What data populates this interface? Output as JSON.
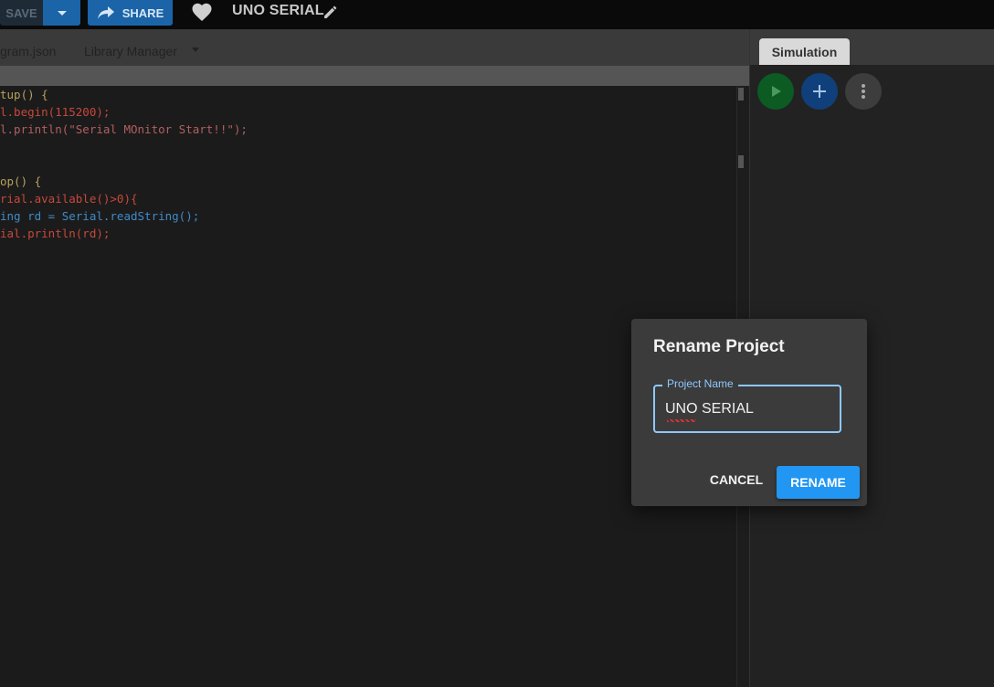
{
  "toolbar": {
    "save_label": "SAVE",
    "share_label": "SHARE",
    "project_title": "UNO SERIAL"
  },
  "editor": {
    "tabs": [
      {
        "label": "gram.json"
      },
      {
        "label": "Library Manager"
      }
    ],
    "code": [
      "tup() {",
      "l.begin(115200);",
      "l.println(\"Serial MOnitor Start!!\");",
      "",
      "",
      "op() {",
      "rial.available()>0){",
      "ing rd = Serial.readString();",
      "ial.println(rd);"
    ]
  },
  "simulation": {
    "tab_label": "Simulation"
  },
  "modal": {
    "title": "Rename Project",
    "field_label": "Project Name",
    "field_value": "UNO SERIAL",
    "cancel_label": "CANCEL",
    "rename_label": "RENAME"
  },
  "colors": {
    "accent": "#2196f3",
    "play_button": "#0b5b22",
    "add_button": "#10407b"
  }
}
